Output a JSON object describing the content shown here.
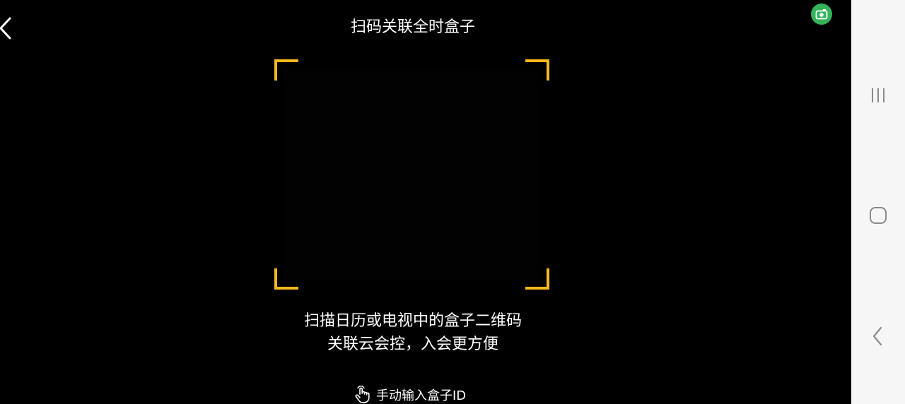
{
  "header": {
    "title": "扫码关联全时盒子",
    "back_icon": "chevron-left-icon"
  },
  "scanner": {
    "accent_color": "#f5b81c",
    "hint_line1": "扫描日历或电视中的盒子二维码",
    "hint_line2": "关联云会控，入会更方便"
  },
  "manual_entry": {
    "icon": "tap-hand-icon",
    "label": "手动输入盒子ID"
  },
  "overlay": {
    "screen_recorder_icon": "camera-icon",
    "color": "#34b35a"
  },
  "system_nav": {
    "recents_icon": "recents-icon",
    "home_icon": "home-icon",
    "back_icon": "back-icon"
  }
}
